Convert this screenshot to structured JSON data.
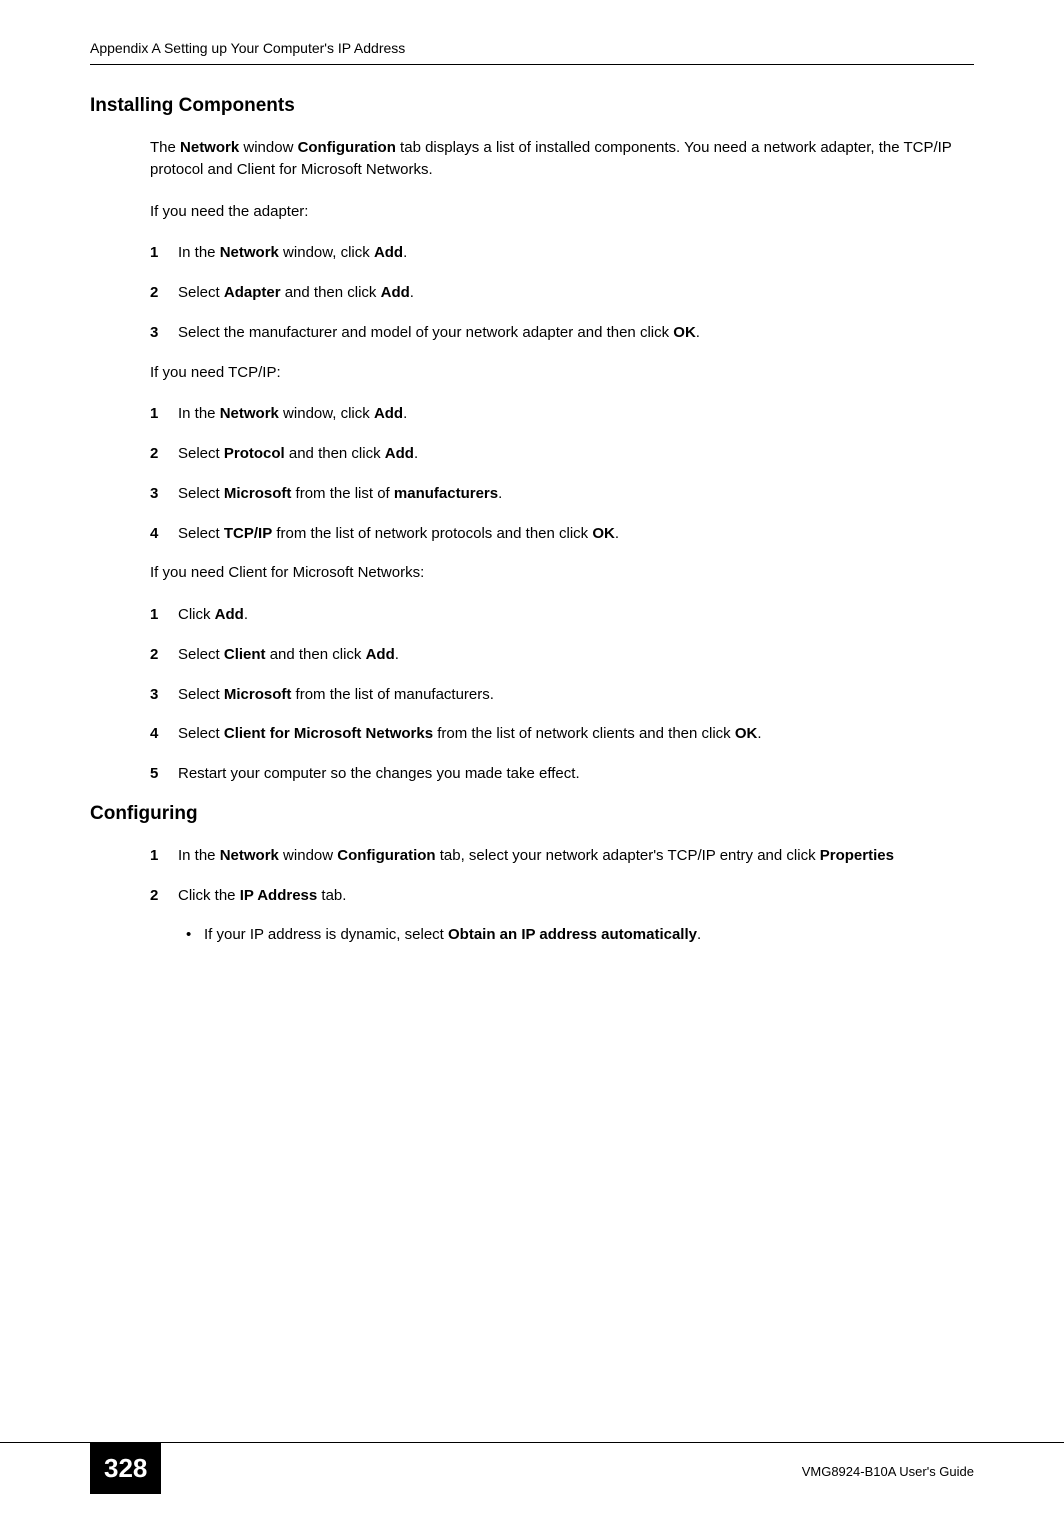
{
  "header": {
    "title": "Appendix A Setting up Your Computer's IP Address"
  },
  "section_installing": {
    "heading": "Installing Components",
    "intro_part1": "The ",
    "intro_bold1": "Network",
    "intro_part2": " window ",
    "intro_bold2": "Configuration",
    "intro_part3": " tab displays a list of installed components. You need a network adapter, the TCP/IP protocol and Client for Microsoft Networks.",
    "need_adapter": "If you need the adapter:",
    "adapter_steps": [
      {
        "num": "1",
        "pre": "In the ",
        "b1": "Network",
        "mid": " window, click ",
        "b2": "Add",
        "post": "."
      },
      {
        "num": "2",
        "pre": "Select ",
        "b1": "Adapter",
        "mid": " and then click ",
        "b2": "Add",
        "post": "."
      },
      {
        "num": "3",
        "pre": "Select the manufacturer and model of your network adapter and then click ",
        "b1": "OK",
        "mid": "",
        "b2": "",
        "post": "."
      }
    ],
    "need_tcpip": "If you need TCP/IP:",
    "tcpip_steps": [
      {
        "num": "1",
        "pre": "In the ",
        "b1": "Network",
        "mid": " window, click ",
        "b2": "Add",
        "post": "."
      },
      {
        "num": "2",
        "pre": "Select ",
        "b1": "Protocol",
        "mid": " and then click ",
        "b2": "Add",
        "post": "."
      },
      {
        "num": "3",
        "pre": "Select ",
        "b1": "Microsoft",
        "mid": " from the list of ",
        "b2": "manufacturers",
        "post": "."
      },
      {
        "num": "4",
        "pre": "Select ",
        "b1": "TCP/IP",
        "mid": " from the list of network protocols and then click ",
        "b2": "OK",
        "post": "."
      }
    ],
    "need_client": "If you need Client for Microsoft Networks:",
    "client_steps": [
      {
        "num": "1",
        "pre": "Click ",
        "b1": "Add",
        "mid": "",
        "b2": "",
        "post": "."
      },
      {
        "num": "2",
        "pre": "Select ",
        "b1": "Client",
        "mid": " and then click ",
        "b2": "Add",
        "post": "."
      },
      {
        "num": "3",
        "pre": "Select ",
        "b1": "Microsoft",
        "mid": " from the list of manufacturers.",
        "b2": "",
        "post": ""
      },
      {
        "num": "4",
        "pre": "Select ",
        "b1": "Client for Microsoft Networks",
        "mid": " from the list of network clients and then click ",
        "b2": "OK",
        "post": "."
      },
      {
        "num": "5",
        "pre": "Restart your computer so the changes you made take effect.",
        "b1": "",
        "mid": "",
        "b2": "",
        "post": ""
      }
    ]
  },
  "section_configuring": {
    "heading": "Configuring",
    "step1": {
      "num": "1",
      "pre": "In the ",
      "b1": "Network",
      "mid1": " window ",
      "b2": "Configuration",
      "mid2": " tab, select your network adapter's TCP/IP entry and click ",
      "b3": "Properties"
    },
    "step2": {
      "num": "2",
      "pre": "Click the ",
      "b1": "IP Address",
      "post": " tab."
    },
    "bullet": {
      "dot": "•",
      "pre": "If your IP address is dynamic, select ",
      "b1": "Obtain an IP address automatically",
      "post": "."
    }
  },
  "footer": {
    "page_number": "328",
    "guide": "VMG8924-B10A User's Guide"
  }
}
